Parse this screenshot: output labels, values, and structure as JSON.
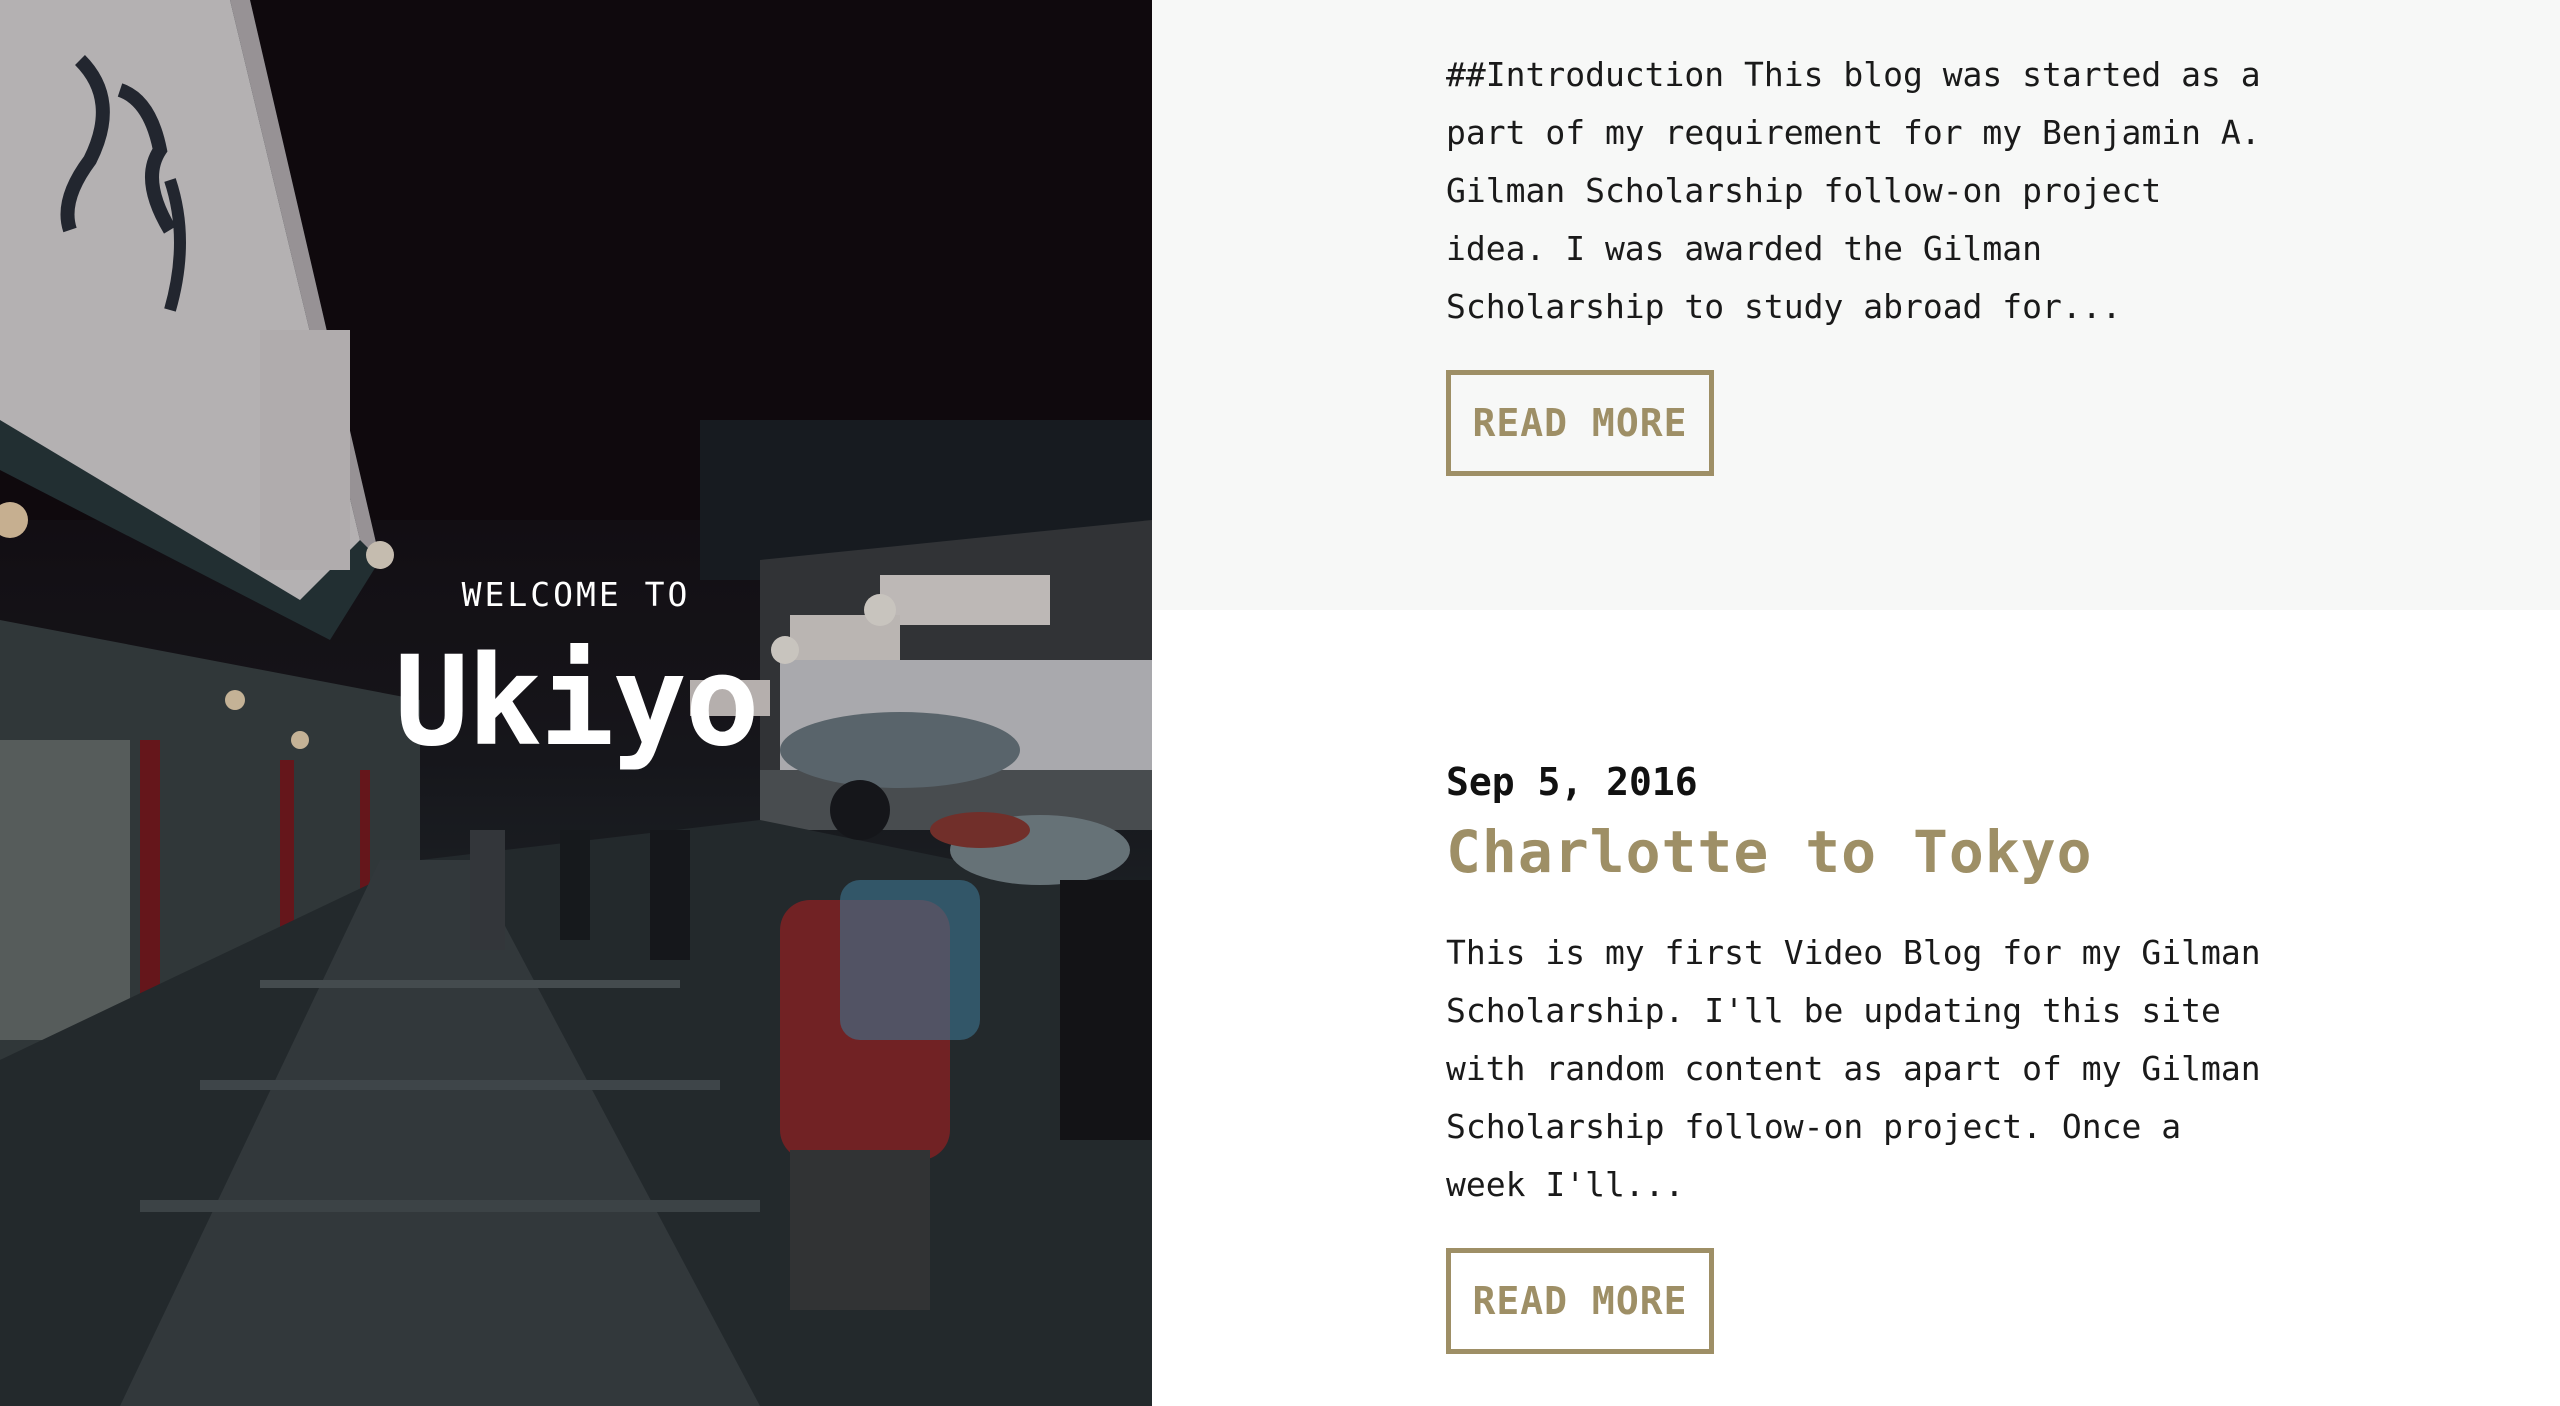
{
  "hero": {
    "welcome": "WELCOME TO",
    "title": "Ukiyo"
  },
  "posts": [
    {
      "excerpt": "##Introduction This blog was started as a part of my requirement for my Benjamin A. Gilman Scholarship follow-on project idea. I was awarded the Gilman Scholarship to study abroad for...",
      "read_more": "READ MORE"
    },
    {
      "date": "Sep 5, 2016",
      "title": "Charlotte to Tokyo",
      "excerpt": "This is my first Video Blog for my Gilman Scholarship. I'll be updating this site with random content as apart of my Gilman Scholarship follow-on project. Once a week I'll...",
      "read_more": "READ MORE"
    }
  ],
  "colors": {
    "accent": "#9e8f66",
    "text": "#1a1a1a",
    "top_post_bg": "#f7f8f7",
    "hero_bg": "#120a10"
  }
}
